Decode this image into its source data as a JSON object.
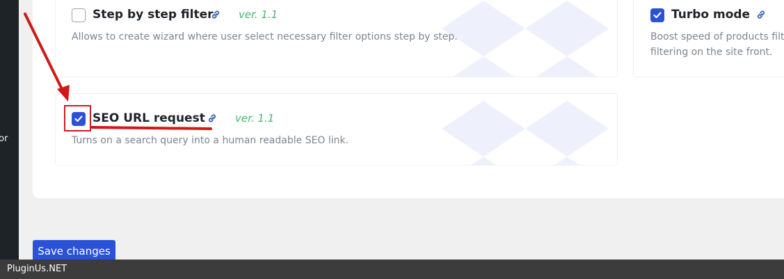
{
  "sidebar": {
    "label": "or"
  },
  "extensions": [
    {
      "title": "Step by step filter",
      "version": "ver. 1.1",
      "description": "Allows to create wizard where user select necessary filter options step by step.",
      "checked": false,
      "icon": "link-icon"
    },
    {
      "title": "Turbo mode",
      "version": "",
      "description_lines": [
        "Boost speed of products filte",
        "filtering on the site front."
      ],
      "checked": true,
      "icon": "link-icon"
    },
    {
      "title": "SEO URL request",
      "version": "ver. 1.1",
      "description": "Turns on a search query into a human readable SEO link.",
      "checked": true,
      "icon": "link-icon"
    }
  ],
  "actions": {
    "save_label": "Save changes"
  },
  "footer": {
    "brand": "PluginUs.NET"
  },
  "colors": {
    "accent": "#2b52d6",
    "version": "#4ab56f",
    "annotation": "#d01818"
  }
}
